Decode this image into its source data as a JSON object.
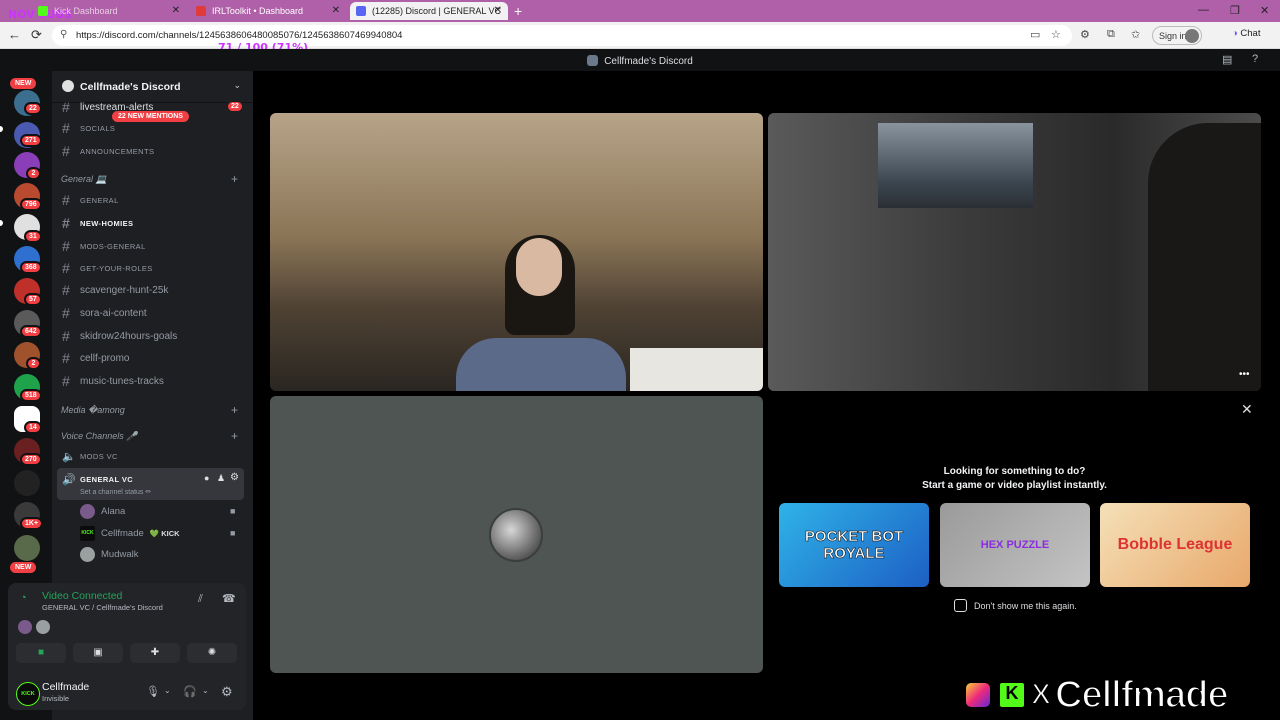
{
  "browser": {
    "tabs": [
      {
        "label": "Kick Dashboard",
        "favicon_color": "#53fc18"
      },
      {
        "label": "IRLToolkit • Dashboard",
        "favicon_color": "#e03a3a"
      },
      {
        "label": "(12285) Discord | GENERAL VC",
        "favicon_color": "#5865f2"
      }
    ],
    "url": "https://discord.com/channels/1245638606480085076/1245638607469940804",
    "signin_label": "Sign in",
    "chat_label": "Chat",
    "overlay_text_1": "NOV SUBS",
    "overlay_text_2": "71 / 100 (71%)"
  },
  "discord": {
    "title": "Cellfmade's Discord",
    "server_name": "Cellfmade's Discord",
    "rail": {
      "new_label": "NEW",
      "badges": [
        "22",
        "271",
        "2",
        "796",
        "31",
        "368",
        "57",
        "642",
        "2",
        "518",
        "14",
        "270",
        "1K+"
      ],
      "new_label_bottom": "NEW"
    },
    "mentions_pill": "22 NEW MENTIONS",
    "channels_top": [
      {
        "name": "livestream-alerts",
        "count": "22"
      },
      {
        "name": "SOCIALS"
      },
      {
        "name": "ANNOUNCEMENTS"
      }
    ],
    "cat_general": "General 💻",
    "channels_general": [
      {
        "name": "GENERAL",
        "small": true
      },
      {
        "name": "NEW-HOMIES",
        "small": true,
        "bright": true
      },
      {
        "name": "MODS-GENERAL",
        "small": true
      },
      {
        "name": "GET-YOUR-ROLES",
        "small": true
      },
      {
        "name": "scavenger-hunt-25k"
      },
      {
        "name": "sora-ai-content"
      },
      {
        "name": "skidrow24hours-goals"
      },
      {
        "name": "cellf-promo"
      },
      {
        "name": "music-tunes-tracks"
      }
    ],
    "cat_media": "Media �among",
    "cat_voice": "Voice Channels 🎤",
    "mods_vc": "MODS VC",
    "general_vc": "GENERAL VC",
    "channel_status": "Set a channel status ✏",
    "voice_users": [
      {
        "name": "Alana"
      },
      {
        "name": "Cellfmade",
        "tag": "💚 KICK"
      },
      {
        "name": "Mudwalk"
      }
    ],
    "panel": {
      "connected": "Video Connected",
      "sub": "GENERAL VC / Cellfmade's Discord",
      "username": "Cellfmade",
      "status": "Invisible",
      "kick_tag": "KICK"
    },
    "activity": {
      "title_1": "Looking for something to do?",
      "title_2": "Start a game or video playlist instantly.",
      "games": [
        "POCKET BOT ROYALE",
        "HEX PUZZLE",
        "Bobble League"
      ],
      "dont_show": "Don't show me this again."
    },
    "brand": {
      "x": "X",
      "name": "Cellfmade"
    }
  }
}
